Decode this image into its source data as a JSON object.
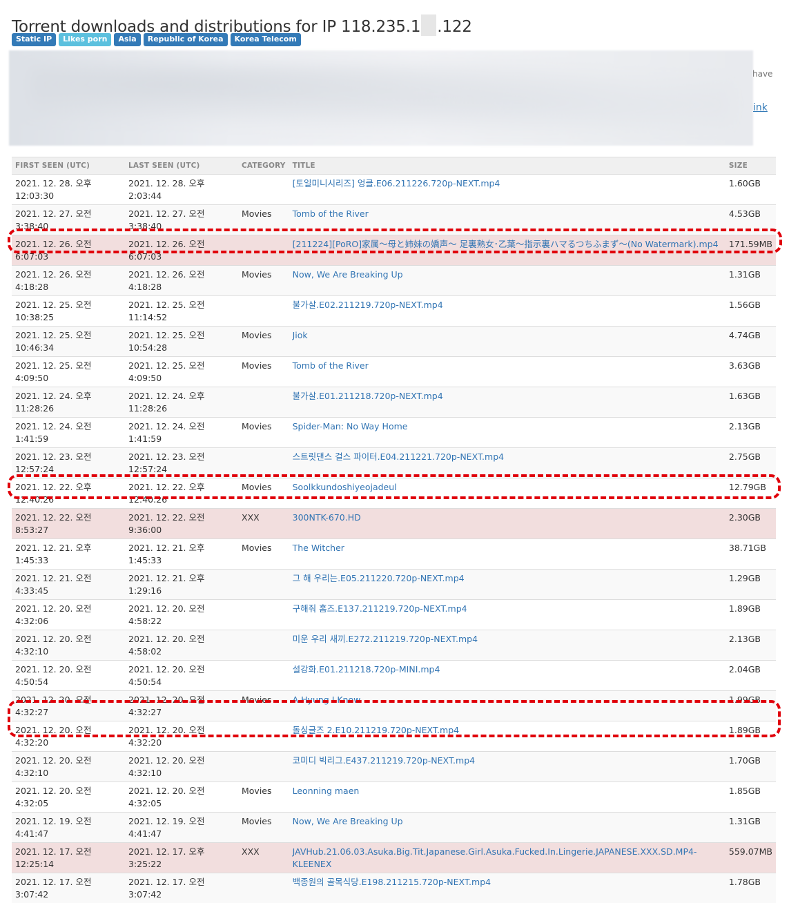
{
  "page": {
    "title_prefix": "Torrent downloads and distributions for IP 118.235.1",
    "title_suffix": ".122"
  },
  "tags": [
    {
      "label": "Static IP",
      "color": "#337ab7"
    },
    {
      "label": "Likes porn",
      "color": "#5bc0de"
    },
    {
      "label": "Asia",
      "color": "#337ab7"
    },
    {
      "label": "Republic of Korea",
      "color": "#337ab7"
    },
    {
      "label": "Korea Telecom",
      "color": "#337ab7"
    }
  ],
  "notice": {
    "tail_text": "have",
    "tail_link": "ink"
  },
  "table": {
    "headers": [
      "FIRST SEEN (UTC)",
      "LAST SEEN (UTC)",
      "CATEGORY",
      "TITLE",
      "SIZE"
    ],
    "rows": [
      {
        "first": "2021. 12. 28. 오후 12:03:30",
        "last": "2021. 12. 28. 오후 2:03:44",
        "category": "",
        "title": "[토일미니시리즈] 엉클.E06.211226.720p-NEXT.mp4",
        "size": "1.60GB"
      },
      {
        "first": "2021. 12. 27. 오전 3:38:40",
        "last": "2021. 12. 27. 오전 3:38:40",
        "category": "Movies",
        "title": "Tomb of the River",
        "size": "4.53GB"
      },
      {
        "first": "2021. 12. 26. 오전 6:07:03",
        "last": "2021. 12. 26. 오전 6:07:03",
        "category": "",
        "title": "[211224][PoRO]家属～母と姉妹の嬌声～ 足裏熟女･乙葉～指示裏ハマるつちふまず～(No Watermark).mp4",
        "size": "171.59MB"
      },
      {
        "first": "2021. 12. 26. 오전 4:18:28",
        "last": "2021. 12. 26. 오전 4:18:28",
        "category": "Movies",
        "title": "Now, We Are Breaking Up",
        "size": "1.31GB"
      },
      {
        "first": "2021. 12. 25. 오전 10:38:25",
        "last": "2021. 12. 25. 오전 11:14:52",
        "category": "",
        "title": "불가살.E02.211219.720p-NEXT.mp4",
        "size": "1.56GB"
      },
      {
        "first": "2021. 12. 25. 오전 10:46:34",
        "last": "2021. 12. 25. 오전 10:54:28",
        "category": "Movies",
        "title": "Jiok",
        "size": "4.74GB"
      },
      {
        "first": "2021. 12. 25. 오전 4:09:50",
        "last": "2021. 12. 25. 오전 4:09:50",
        "category": "Movies",
        "title": "Tomb of the River",
        "size": "3.63GB"
      },
      {
        "first": "2021. 12. 24. 오후 11:28:26",
        "last": "2021. 12. 24. 오후 11:28:26",
        "category": "",
        "title": "불가살.E01.211218.720p-NEXT.mp4",
        "size": "1.63GB"
      },
      {
        "first": "2021. 12. 24. 오전 1:41:59",
        "last": "2021. 12. 24. 오전 1:41:59",
        "category": "Movies",
        "title": "Spider-Man: No Way Home",
        "size": "2.13GB"
      },
      {
        "first": "2021. 12. 23. 오전 12:57:24",
        "last": "2021. 12. 23. 오전 12:57:24",
        "category": "",
        "title": "스트릿댄스 걸스 파이터.E04.211221.720p-NEXT.mp4",
        "size": "2.75GB"
      },
      {
        "first": "2021. 12. 22. 오후 12:40:26",
        "last": "2021. 12. 22. 오후 12:40:26",
        "category": "Movies",
        "title": "Soolkkundoshiyeojadeul",
        "size": "12.79GB"
      },
      {
        "first": "2021. 12. 22. 오전 8:53:27",
        "last": "2021. 12. 22. 오전 9:36:00",
        "category": "XXX",
        "title": "300NTK-670.HD",
        "size": "2.30GB"
      },
      {
        "first": "2021. 12. 21. 오후 1:45:33",
        "last": "2021. 12. 21. 오후 1:45:33",
        "category": "Movies",
        "title": "The Witcher",
        "size": "38.71GB"
      },
      {
        "first": "2021. 12. 21. 오전 4:33:45",
        "last": "2021. 12. 21. 오후 1:29:16",
        "category": "",
        "title": "그 해 우리는.E05.211220.720p-NEXT.mp4",
        "size": "1.29GB"
      },
      {
        "first": "2021. 12. 20. 오전 4:32:06",
        "last": "2021. 12. 20. 오전 4:58:22",
        "category": "",
        "title": "구해줘 홈즈.E137.211219.720p-NEXT.mp4",
        "size": "1.89GB"
      },
      {
        "first": "2021. 12. 20. 오전 4:32:10",
        "last": "2021. 12. 20. 오전 4:58:02",
        "category": "",
        "title": "미운 우리 새끼.E272.211219.720p-NEXT.mp4",
        "size": "2.13GB"
      },
      {
        "first": "2021. 12. 20. 오전 4:50:54",
        "last": "2021. 12. 20. 오전 4:50:54",
        "category": "",
        "title": "설강화.E01.211218.720p-MINI.mp4",
        "size": "2.04GB"
      },
      {
        "first": "2021. 12. 20. 오전 4:32:27",
        "last": "2021. 12. 20. 오전 4:32:27",
        "category": "Movies",
        "title": "A Hyung I Know",
        "size": "1.99GB"
      },
      {
        "first": "2021. 12. 20. 오전 4:32:20",
        "last": "2021. 12. 20. 오전 4:32:20",
        "category": "",
        "title": "돌싱글즈 2.E10.211219.720p-NEXT.mp4",
        "size": "1.89GB"
      },
      {
        "first": "2021. 12. 20. 오전 4:32:10",
        "last": "2021. 12. 20. 오전 4:32:10",
        "category": "",
        "title": "코미디 빅리그.E437.211219.720p-NEXT.mp4",
        "size": "1.70GB"
      },
      {
        "first": "2021. 12. 20. 오전 4:32:05",
        "last": "2021. 12. 20. 오전 4:32:05",
        "category": "Movies",
        "title": "Leonning maen",
        "size": "1.85GB"
      },
      {
        "first": "2021. 12. 19. 오전 4:41:47",
        "last": "2021. 12. 19. 오전 4:41:47",
        "category": "Movies",
        "title": "Now, We Are Breaking Up",
        "size": "1.31GB"
      },
      {
        "first": "2021. 12. 17. 오전 12:25:14",
        "last": "2021. 12. 17. 오후 3:25:22",
        "category": "XXX",
        "title": "JAVHub.21.06.03.Asuka.Big.Tit.Japanese.Girl.Asuka.Fucked.In.Lingerie.JAPANESE.XXX.SD.MP4-KLEENEX",
        "size": "559.07MB"
      },
      {
        "first": "2021. 12. 17. 오전 3:07:42",
        "last": "2021. 12. 17. 오전 3:07:42",
        "category": "",
        "title": "백종원의 골목식당.E198.211215.720p-NEXT.mp4",
        "size": "1.78GB"
      }
    ]
  }
}
